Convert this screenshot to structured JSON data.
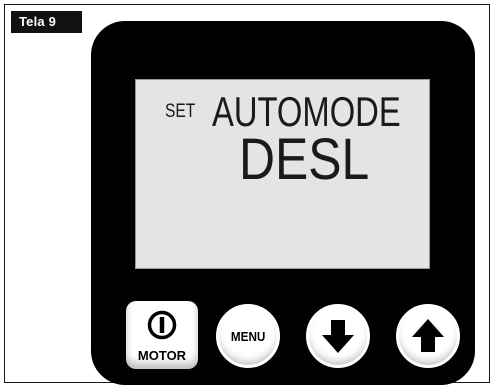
{
  "figure": {
    "tag": "Tela 9"
  },
  "display": {
    "set_label": "SET",
    "mode": "AUTOMODE",
    "value": "DESL"
  },
  "buttons": {
    "motor_label": "MOTOR",
    "menu_label": "MENU",
    "down_icon": "arrow-down-icon",
    "up_icon": "arrow-up-icon",
    "power_icon": "power-icon"
  }
}
